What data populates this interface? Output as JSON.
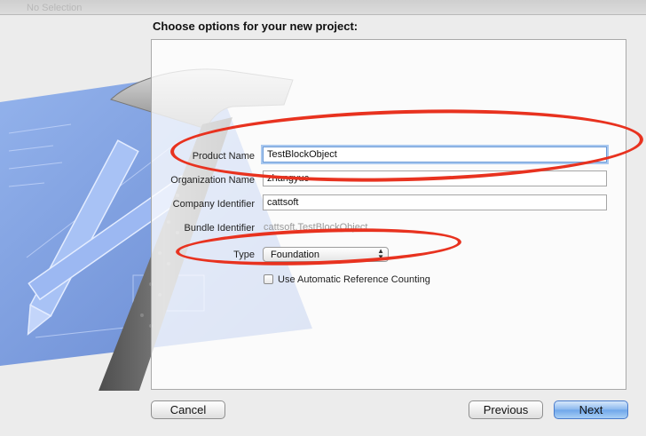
{
  "window": {
    "top_text": "No Selection"
  },
  "heading": "Choose options for your new project:",
  "form": {
    "product_name": {
      "label": "Product Name",
      "value": "TestBlockObject"
    },
    "organization_name": {
      "label": "Organization Name",
      "value": "zhangyuc"
    },
    "company_identifier": {
      "label": "Company Identifier",
      "value": "cattsoft"
    },
    "bundle_identifier": {
      "label": "Bundle Identifier",
      "value": "cattsoft.TestBlockObject"
    },
    "type": {
      "label": "Type",
      "value": "Foundation"
    },
    "arc_checkbox": {
      "label": "Use Automatic Reference Counting",
      "checked": false
    }
  },
  "buttons": {
    "cancel": "Cancel",
    "previous": "Previous",
    "next": "Next"
  },
  "colors": {
    "annotation": "#e8321f",
    "focus": "#a9c8ef",
    "blueprint": "#6d8fd6"
  }
}
